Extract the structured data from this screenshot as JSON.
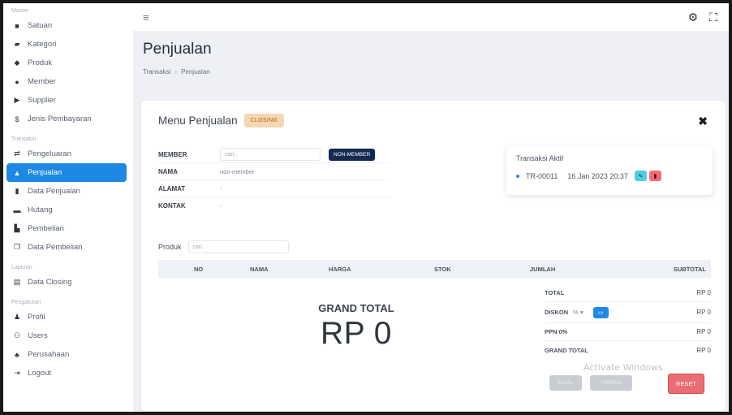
{
  "sidebar": {
    "sections": {
      "master": "Master",
      "transaksi": "Transaksi",
      "laporan": "Laporan",
      "pengaturan": "Pengaturan"
    },
    "items": [
      {
        "label": "Satuan",
        "icon": "folder-icon"
      },
      {
        "label": "Kategori",
        "icon": "folder-open-icon"
      },
      {
        "label": "Produk",
        "icon": "cube-icon"
      },
      {
        "label": "Member",
        "icon": "user-icon"
      },
      {
        "label": "Supplier",
        "icon": "truck-icon"
      },
      {
        "label": "Jenis Pembayaran",
        "icon": "dollar-icon"
      },
      {
        "label": "Pengeluaran",
        "icon": "exchange-icon"
      },
      {
        "label": "Penjualan",
        "icon": "triangle-icon",
        "active": true
      },
      {
        "label": "Data Penjualan",
        "icon": "file-icon"
      },
      {
        "label": "Hutang",
        "icon": "money-icon"
      },
      {
        "label": "Pembelian",
        "icon": "truck-loaded-icon"
      },
      {
        "label": "Data Pembelian",
        "icon": "copy-icon"
      },
      {
        "label": "Data Closing",
        "icon": "file-text-icon"
      },
      {
        "label": "Profil",
        "icon": "user-tie-icon"
      },
      {
        "label": "Users",
        "icon": "users-icon"
      },
      {
        "label": "Perusahaan",
        "icon": "building-icon"
      },
      {
        "label": "Logout",
        "icon": "logout-icon"
      }
    ]
  },
  "header": {
    "page_title": "Penjualan",
    "breadcrumb": [
      "Transaksi",
      "Penjualan"
    ]
  },
  "card": {
    "title": "Menu Penjualan",
    "closing_badge": "CLOSING"
  },
  "member": {
    "labels": {
      "member": "MEMBER",
      "nama": "NAMA",
      "alamat": "ALAMAT",
      "kontak": "KONTAK"
    },
    "search_placeholder": "cari..",
    "non_member_button": "NON-MEMBER",
    "nama": "non-member",
    "alamat": "-",
    "kontak": "-"
  },
  "transaksi_aktif": {
    "title": "Transaksi Aktif",
    "code": "TR-00011",
    "datetime": "16 Jan 2023 20:37"
  },
  "produk": {
    "label": "Produk",
    "search_placeholder": "cari..",
    "columns": [
      "NO",
      "NAMA",
      "HARGA",
      "STOK",
      "JUMLAH",
      "SUBTOTAL"
    ]
  },
  "grand_total": {
    "label": "GRAND TOTAL",
    "value": "RP 0"
  },
  "totals": {
    "total_label": "TOTAL",
    "total_value": "RP 0",
    "diskon_label": "DISKON",
    "diskon_unit": "%",
    "diskon_value": "RP 0",
    "ppn_label": "PPN 0%",
    "ppn_value": "RP 0",
    "grand_label": "GRAND TOTAL",
    "grand_value": "RP 0"
  },
  "actions": {
    "btn1": "BATAL",
    "btn2": "SIMPAN",
    "reset": "RESET"
  },
  "watermark": "Activate Windows",
  "colors": {
    "accent": "#1e88e5",
    "navy": "#142a52",
    "closing_bg": "#f6d7b3",
    "reset": "#ea6d72"
  }
}
